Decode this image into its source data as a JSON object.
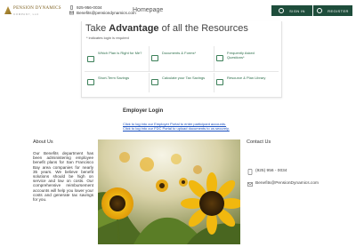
{
  "header": {
    "logo_name": "PENSION DYNAMICS",
    "logo_sub": "COMPANY, LLC",
    "phone": "925-956-0034",
    "email": "Benefits@pensiondynamics.com",
    "homepage_label": "Homepage",
    "sign_in_label": "SIGN IN",
    "register_label": "REGISTER"
  },
  "resources": {
    "title_prefix": "Take ",
    "title_bold": "Advantage",
    "title_suffix": " of all the Resources",
    "required_note": "* indicates login is required",
    "items": [
      {
        "label": "Which Plan is Right for Me?",
        "icon": "monitor-icon"
      },
      {
        "label": "Documents & Forms*",
        "icon": "document-icon"
      },
      {
        "label": "Frequently Asked Questions*",
        "icon": "question-icon"
      },
      {
        "label": "Short-Term Savings",
        "icon": "piggy-bank-icon"
      },
      {
        "label": "Calculate your Tax Savings",
        "icon": "calculator-icon"
      },
      {
        "label": "Resource & Plan Library",
        "icon": "library-icon"
      }
    ]
  },
  "employer": {
    "title": "Employer Login",
    "link1": "Click to log into our Employer Portal to enter participant accounts.",
    "link2": "Click to log into our FDC Portal to upload documents to us securely."
  },
  "about": {
    "heading": "About Us",
    "text": "Our Benefits department has been administering employee benefit plans for San Francisco Bay area companies for nearly 35 years. We believe benefit solutions should be high on service and low on costs. Our comprehensive reimbursement accounts will help you lower your costs and generate tax savings for you."
  },
  "contact": {
    "heading": "Contact Us",
    "phone": "(925) 956 - 0034",
    "email": "Benefits@PensionDynamics.com"
  },
  "colors": {
    "brand_green": "#1e4d3b",
    "link_blue": "#1a4fbf",
    "icon_green": "#3b7f58"
  }
}
